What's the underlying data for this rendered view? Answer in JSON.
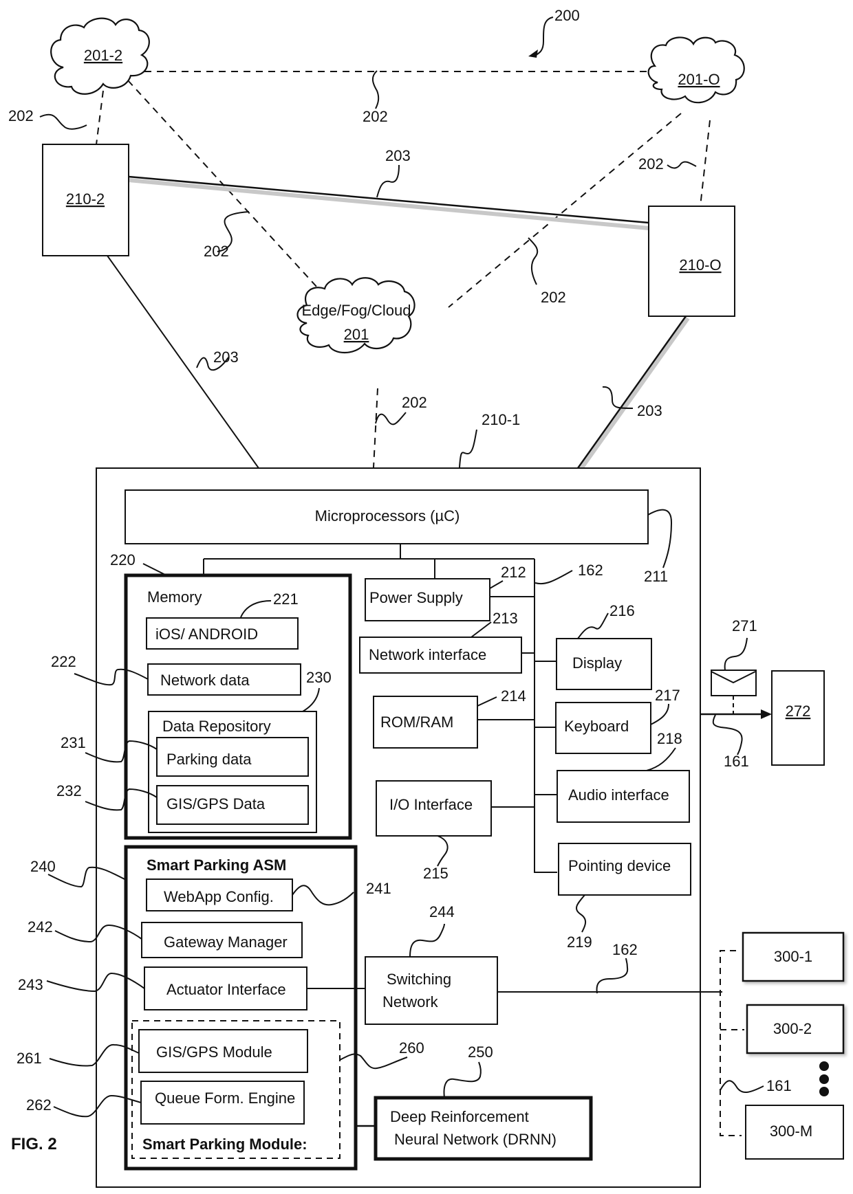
{
  "figure": {
    "title": "FIG. 2",
    "system_ref": "200"
  },
  "clouds": {
    "cloud_201_2": "201-2",
    "cloud_201_o": "201-O",
    "edge_title": "Edge/Fog/Cloud",
    "edge_ref": "201"
  },
  "nodes": {
    "node_210_2": "210-2",
    "node_210_o": "210-O",
    "node_210_1_ref": "210-1",
    "node_272": "272"
  },
  "links": {
    "wireless_ref": "202",
    "wired_ref": "203"
  },
  "device": {
    "microprocessors": "Microprocessors (µC)",
    "microprocessors_ref": "211",
    "bus_ref": "162",
    "memory": {
      "ref": "220",
      "title": "Memory",
      "os_label": "iOS/ ANDROID",
      "os_ref": "221",
      "network_data": "Network data",
      "network_data_ref": "222",
      "repository_title": "Data Repository",
      "repository_ref": "230",
      "parking_data": "Parking data",
      "parking_data_ref": "231",
      "gis_data": "GIS/GPS Data",
      "gis_data_ref": "232"
    },
    "power_supply": "Power Supply",
    "power_supply_ref": "212",
    "network_interface": "Network interface",
    "network_interface_ref": "213",
    "rom_ram": "ROM/RAM",
    "rom_ram_ref": "214",
    "io_interface": "I/O Interface",
    "io_interface_ref": "215",
    "display": "Display",
    "display_ref": "216",
    "keyboard": "Keyboard",
    "keyboard_ref": "217",
    "audio_interface": "Audio interface",
    "audio_interface_ref": "218",
    "pointing_device": "Pointing device",
    "pointing_device_ref": "219",
    "asm": {
      "title": "Smart Parking ASM",
      "ref": "240",
      "webapp_config": "WebApp Config.",
      "webapp_config_ref": "241",
      "gateway_manager": "Gateway Manager",
      "gateway_manager_ref": "242",
      "actuator_interface": "Actuator Interface",
      "actuator_interface_ref": "243",
      "module_title": "Smart Parking Module:",
      "module_ref": "260",
      "gis_module": "GIS/GPS Module",
      "gis_module_ref": "261",
      "queue_engine": "Queue Form. Engine",
      "queue_engine_ref": "262"
    },
    "switching_line1": "Switching",
    "switching_line2": "Network",
    "switching_ref": "244",
    "drnn_line1": "Deep Reinforcement",
    "drnn_line2": "Neural Network (DRNN)",
    "drnn_ref": "250"
  },
  "external": {
    "message_ref": "271",
    "link_ref": "161",
    "actuators": [
      "300-1",
      "300-2",
      "300-M"
    ],
    "actuator_link_ref": "161",
    "actuator_bus_ref": "162"
  }
}
